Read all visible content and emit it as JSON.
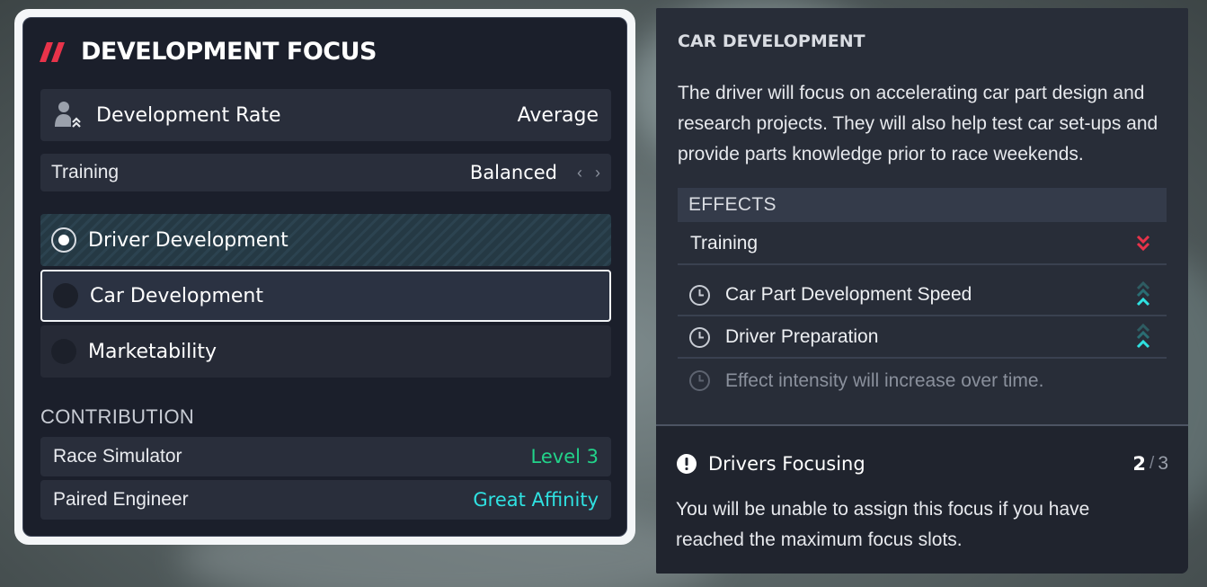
{
  "colors": {
    "accent_red": "#e8334a",
    "green_value": "#22d38a",
    "cyan_value": "#2fe1e1",
    "warning_pink": "#e8334a"
  },
  "focus_panel": {
    "title": "DEVELOPMENT FOCUS",
    "development_rate": {
      "label": "Development Rate",
      "value": "Average",
      "icon": "driver-development-icon"
    },
    "training": {
      "label": "Training",
      "value": "Balanced"
    },
    "options": [
      {
        "label": "Driver Development",
        "selected": true
      },
      {
        "label": "Car Development",
        "selected": false,
        "highlighted": true
      },
      {
        "label": "Marketability",
        "selected": false
      }
    ],
    "contribution": {
      "title": "CONTRIBUTION",
      "rows": [
        {
          "label": "Race Simulator",
          "value": "Level 3"
        },
        {
          "label": "Paired Engineer",
          "value": "Great Affinity"
        }
      ]
    }
  },
  "detail_panel": {
    "title": "CAR DEVELOPMENT",
    "description": "The driver will focus on accelerating car part design and research projects. They will also help test car set-ups and provide parts knowledge prior to race weekends.",
    "effects": {
      "title": "EFFECTS",
      "rows": [
        {
          "label": "Training",
          "direction": "decrease"
        },
        {
          "label": "Car Part Development Speed",
          "direction": "increase",
          "icon": "clock-icon"
        },
        {
          "label": "Driver Preparation",
          "direction": "increase",
          "icon": "clock-icon"
        }
      ],
      "note": "Effect intensity will increase over time."
    },
    "drivers_focusing": {
      "label": "Drivers Focusing",
      "current": "2",
      "separator": "/",
      "max": "3",
      "description": "You will be unable to assign this focus if you have reached the maximum focus slots."
    }
  }
}
